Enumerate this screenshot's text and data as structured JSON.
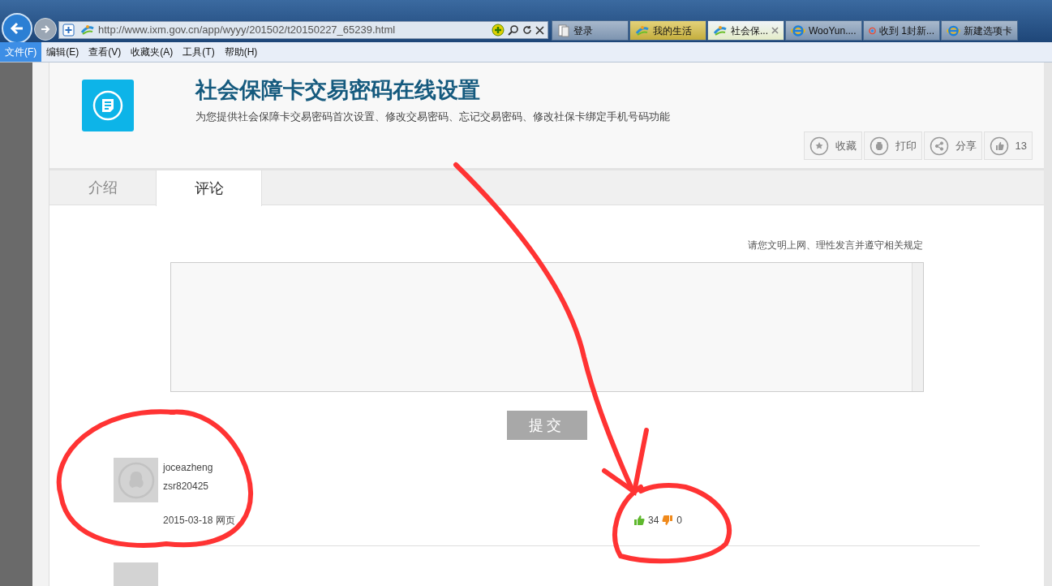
{
  "browser": {
    "url": "http://www.ixm.gov.cn/app/wyyy/201502/t20150227_65239.html",
    "tabs": [
      {
        "label": "登录",
        "kind": "doc",
        "selected": false,
        "highlighted": false
      },
      {
        "label": "我的生活",
        "kind": "site",
        "selected": false,
        "highlighted": true
      },
      {
        "label": "社会保...",
        "kind": "site",
        "selected": true,
        "highlighted": false
      },
      {
        "label": "WooYun....",
        "kind": "ie",
        "selected": false,
        "highlighted": false
      },
      {
        "label": "收到 1封新...",
        "kind": "ring",
        "selected": false,
        "highlighted": false
      },
      {
        "label": "新建选项卡",
        "kind": "ie",
        "selected": false,
        "highlighted": false
      }
    ],
    "menu": [
      {
        "label": "文件(F)",
        "selected": true
      },
      {
        "label": "编辑(E)",
        "selected": false
      },
      {
        "label": "查看(V)",
        "selected": false
      },
      {
        "label": "收藏夹(A)",
        "selected": false
      },
      {
        "label": "工具(T)",
        "selected": false
      },
      {
        "label": "帮助(H)",
        "selected": false
      }
    ]
  },
  "header": {
    "title": "社会保障卡交易密码在线设置",
    "subtitle": "为您提供社会保障卡交易密码首次设置、修改交易密码、忘记交易密码、修改社保卡绑定手机号码功能",
    "actions": [
      {
        "kind": "star",
        "label": "收藏"
      },
      {
        "kind": "print",
        "label": "打印"
      },
      {
        "kind": "share",
        "label": "分享"
      },
      {
        "kind": "like",
        "label": "13"
      }
    ]
  },
  "tabs": [
    {
      "label": "介绍",
      "selected": false
    },
    {
      "label": "评论",
      "selected": true
    }
  ],
  "comment_form": {
    "notice": "请您文明上网、理性发言并遵守相关规定",
    "submit": "提交"
  },
  "comments": [
    {
      "name": "joceazheng",
      "nickname": "zsr820425",
      "meta": "2015-03-18 网页",
      "likes": "34",
      "dislikes": "0"
    }
  ]
}
